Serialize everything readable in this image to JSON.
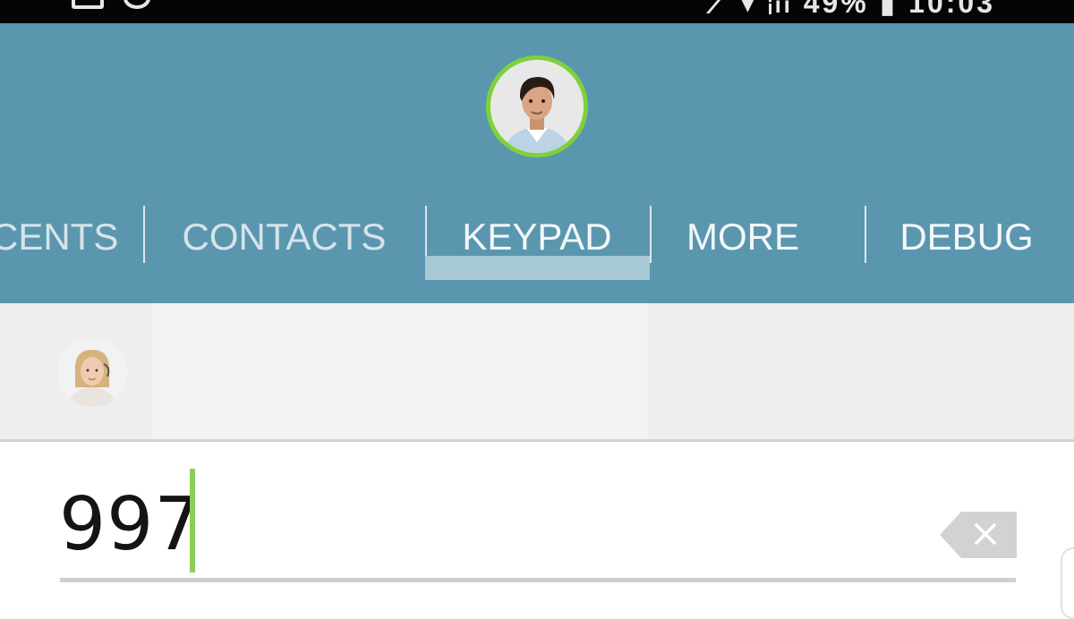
{
  "status_bar": {
    "right_text": "⟋ ▾ ᵢₗₗ 49% ▮ 10:03"
  },
  "profile": {
    "avatar_icon": "user-avatar-male",
    "ring_color": "#7ed13a"
  },
  "tabs": [
    {
      "label": "CENTS"
    },
    {
      "label": "CONTACTS"
    },
    {
      "label": "KEYPAD"
    },
    {
      "label": "MORE"
    },
    {
      "label": "DEBUG"
    }
  ],
  "active_tab": "KEYPAD",
  "suggestion": {
    "avatar_icon": "user-avatar-female"
  },
  "dialer": {
    "number": "997",
    "backspace_icon": "backspace-icon"
  },
  "colors": {
    "header": "#5b96af",
    "accent": "#7ed13a"
  }
}
